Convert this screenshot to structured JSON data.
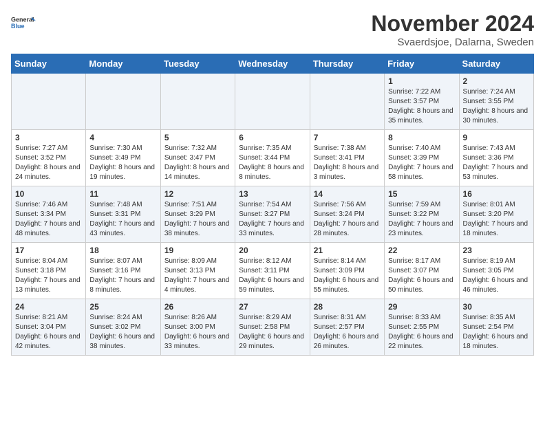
{
  "logo": {
    "line1": "General",
    "line2": "Blue"
  },
  "title": "November 2024",
  "subtitle": "Svaerdsjoe, Dalarna, Sweden",
  "days_of_week": [
    "Sunday",
    "Monday",
    "Tuesday",
    "Wednesday",
    "Thursday",
    "Friday",
    "Saturday"
  ],
  "weeks": [
    [
      {
        "day": "",
        "info": ""
      },
      {
        "day": "",
        "info": ""
      },
      {
        "day": "",
        "info": ""
      },
      {
        "day": "",
        "info": ""
      },
      {
        "day": "",
        "info": ""
      },
      {
        "day": "1",
        "info": "Sunrise: 7:22 AM\nSunset: 3:57 PM\nDaylight: 8 hours and 35 minutes."
      },
      {
        "day": "2",
        "info": "Sunrise: 7:24 AM\nSunset: 3:55 PM\nDaylight: 8 hours and 30 minutes."
      }
    ],
    [
      {
        "day": "3",
        "info": "Sunrise: 7:27 AM\nSunset: 3:52 PM\nDaylight: 8 hours and 24 minutes."
      },
      {
        "day": "4",
        "info": "Sunrise: 7:30 AM\nSunset: 3:49 PM\nDaylight: 8 hours and 19 minutes."
      },
      {
        "day": "5",
        "info": "Sunrise: 7:32 AM\nSunset: 3:47 PM\nDaylight: 8 hours and 14 minutes."
      },
      {
        "day": "6",
        "info": "Sunrise: 7:35 AM\nSunset: 3:44 PM\nDaylight: 8 hours and 8 minutes."
      },
      {
        "day": "7",
        "info": "Sunrise: 7:38 AM\nSunset: 3:41 PM\nDaylight: 8 hours and 3 minutes."
      },
      {
        "day": "8",
        "info": "Sunrise: 7:40 AM\nSunset: 3:39 PM\nDaylight: 7 hours and 58 minutes."
      },
      {
        "day": "9",
        "info": "Sunrise: 7:43 AM\nSunset: 3:36 PM\nDaylight: 7 hours and 53 minutes."
      }
    ],
    [
      {
        "day": "10",
        "info": "Sunrise: 7:46 AM\nSunset: 3:34 PM\nDaylight: 7 hours and 48 minutes."
      },
      {
        "day": "11",
        "info": "Sunrise: 7:48 AM\nSunset: 3:31 PM\nDaylight: 7 hours and 43 minutes."
      },
      {
        "day": "12",
        "info": "Sunrise: 7:51 AM\nSunset: 3:29 PM\nDaylight: 7 hours and 38 minutes."
      },
      {
        "day": "13",
        "info": "Sunrise: 7:54 AM\nSunset: 3:27 PM\nDaylight: 7 hours and 33 minutes."
      },
      {
        "day": "14",
        "info": "Sunrise: 7:56 AM\nSunset: 3:24 PM\nDaylight: 7 hours and 28 minutes."
      },
      {
        "day": "15",
        "info": "Sunrise: 7:59 AM\nSunset: 3:22 PM\nDaylight: 7 hours and 23 minutes."
      },
      {
        "day": "16",
        "info": "Sunrise: 8:01 AM\nSunset: 3:20 PM\nDaylight: 7 hours and 18 minutes."
      }
    ],
    [
      {
        "day": "17",
        "info": "Sunrise: 8:04 AM\nSunset: 3:18 PM\nDaylight: 7 hours and 13 minutes."
      },
      {
        "day": "18",
        "info": "Sunrise: 8:07 AM\nSunset: 3:16 PM\nDaylight: 7 hours and 8 minutes."
      },
      {
        "day": "19",
        "info": "Sunrise: 8:09 AM\nSunset: 3:13 PM\nDaylight: 7 hours and 4 minutes."
      },
      {
        "day": "20",
        "info": "Sunrise: 8:12 AM\nSunset: 3:11 PM\nDaylight: 6 hours and 59 minutes."
      },
      {
        "day": "21",
        "info": "Sunrise: 8:14 AM\nSunset: 3:09 PM\nDaylight: 6 hours and 55 minutes."
      },
      {
        "day": "22",
        "info": "Sunrise: 8:17 AM\nSunset: 3:07 PM\nDaylight: 6 hours and 50 minutes."
      },
      {
        "day": "23",
        "info": "Sunrise: 8:19 AM\nSunset: 3:05 PM\nDaylight: 6 hours and 46 minutes."
      }
    ],
    [
      {
        "day": "24",
        "info": "Sunrise: 8:21 AM\nSunset: 3:04 PM\nDaylight: 6 hours and 42 minutes."
      },
      {
        "day": "25",
        "info": "Sunrise: 8:24 AM\nSunset: 3:02 PM\nDaylight: 6 hours and 38 minutes."
      },
      {
        "day": "26",
        "info": "Sunrise: 8:26 AM\nSunset: 3:00 PM\nDaylight: 6 hours and 33 minutes."
      },
      {
        "day": "27",
        "info": "Sunrise: 8:29 AM\nSunset: 2:58 PM\nDaylight: 6 hours and 29 minutes."
      },
      {
        "day": "28",
        "info": "Sunrise: 8:31 AM\nSunset: 2:57 PM\nDaylight: 6 hours and 26 minutes."
      },
      {
        "day": "29",
        "info": "Sunrise: 8:33 AM\nSunset: 2:55 PM\nDaylight: 6 hours and 22 minutes."
      },
      {
        "day": "30",
        "info": "Sunrise: 8:35 AM\nSunset: 2:54 PM\nDaylight: 6 hours and 18 minutes."
      }
    ]
  ]
}
